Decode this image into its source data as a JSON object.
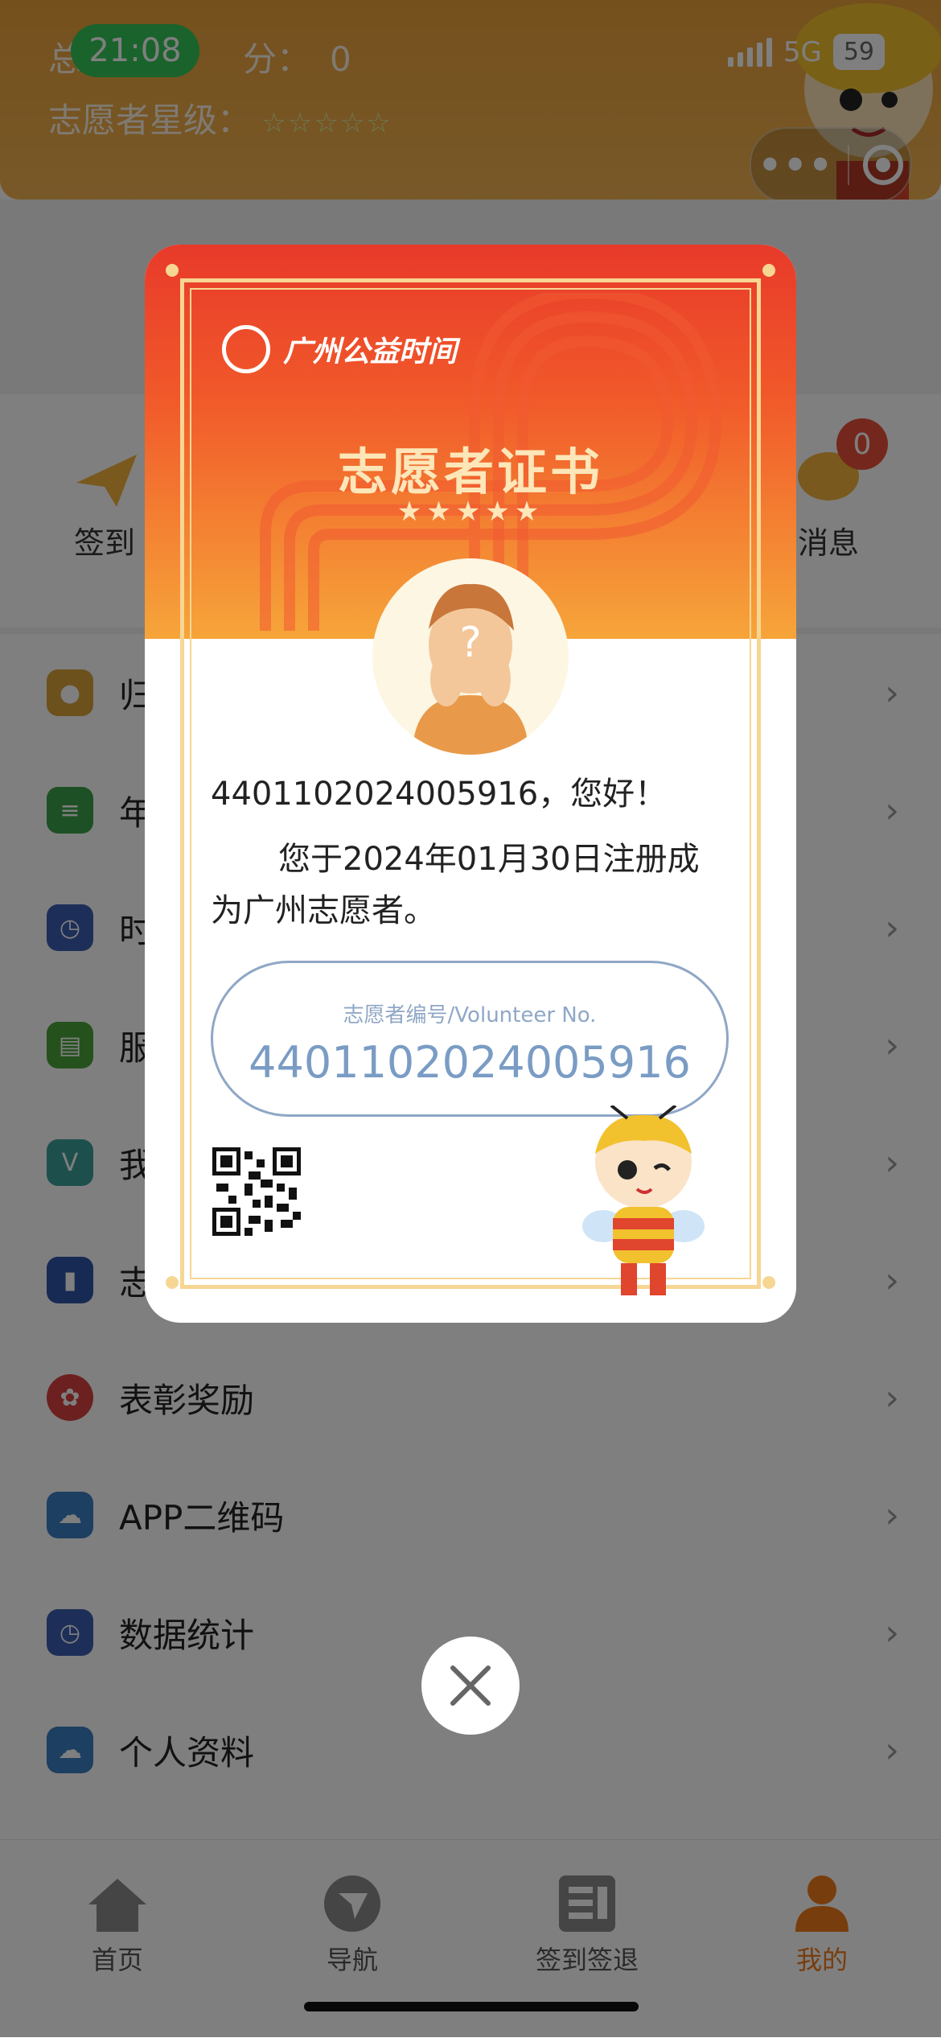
{
  "status_bar": {
    "time": "21:08",
    "network": "5G",
    "battery": "59"
  },
  "header": {
    "total_points_label": "总",
    "total_points_suffix": "分：",
    "total_points_value": "0",
    "star_level_label": "志愿者星级：",
    "star_level_stars": "☆☆☆☆☆"
  },
  "shortcuts": [
    {
      "label": "签到"
    },
    {
      "label": "消息",
      "badge": "0"
    }
  ],
  "menu": {
    "items": [
      {
        "label": "归",
        "icon": "group-icon",
        "color": "#d9a23a"
      },
      {
        "label": "年",
        "icon": "report-icon",
        "color": "#3aa24a"
      },
      {
        "label": "时",
        "icon": "clock-list-icon",
        "color": "#3a5eb0"
      },
      {
        "label": "服",
        "icon": "certificate-icon",
        "color": "#4aa23a"
      },
      {
        "label": "我",
        "icon": "v-badge-icon",
        "color": "#3aa09a"
      },
      {
        "label": "志",
        "icon": "id-card-icon",
        "color": "#2f55a8"
      },
      {
        "label": "表彰奖励",
        "icon": "medal-icon",
        "color": "#d84040"
      },
      {
        "label": "APP二维码",
        "icon": "cloud-icon",
        "color": "#3a7ec2"
      },
      {
        "label": "数据统计",
        "icon": "clock-list-icon",
        "color": "#3a5eb0"
      },
      {
        "label": "个人资料",
        "icon": "cloud-icon",
        "color": "#3a7ec2"
      }
    ]
  },
  "tabbar": {
    "tabs": [
      {
        "label": "首页",
        "icon": "home-icon"
      },
      {
        "label": "导航",
        "icon": "navigation-icon"
      },
      {
        "label": "签到签退",
        "icon": "checkin-icon"
      },
      {
        "label": "我的",
        "icon": "profile-icon",
        "active": true
      }
    ],
    "active_color": "#f07a1a"
  },
  "certificate": {
    "brand": "广州公益时间",
    "title": "志愿者证书",
    "stars": "★★★★★",
    "greeting": "4401102024005916，您好！",
    "body": "您于2024年01月30日注册成为广州志愿者。",
    "number_label": "志愿者编号/Volunteer No.",
    "number_value": "4401102024005916"
  },
  "colors": {
    "accent": "#f07a1a",
    "cert_red": "#e83a2a",
    "number_blue": "#7a9cc4"
  }
}
